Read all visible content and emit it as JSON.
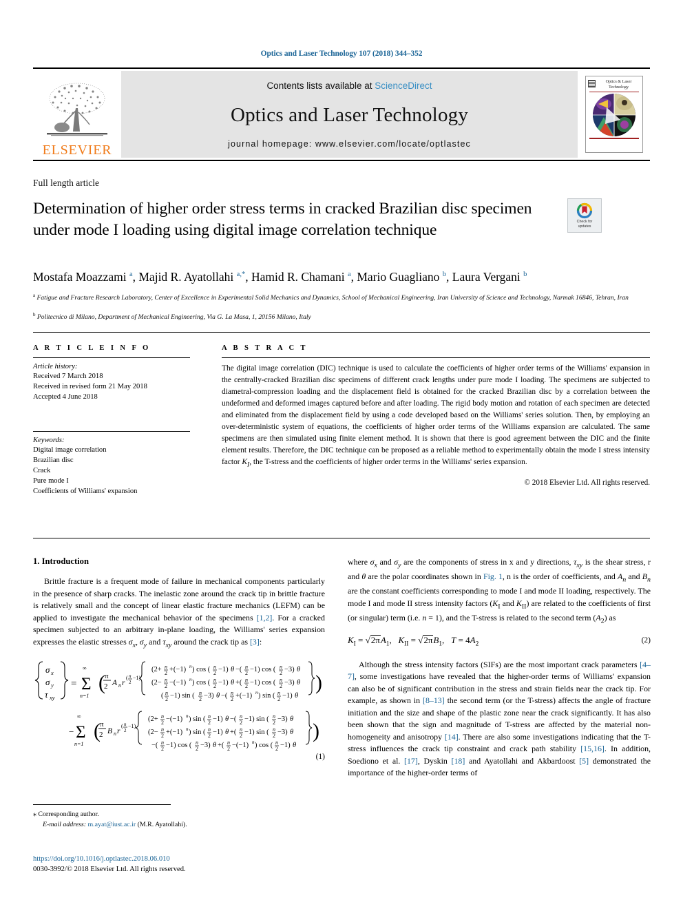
{
  "running_head": "Optics and Laser Technology 107 (2018) 344–352",
  "masthead": {
    "publisher": "ELSEVIER",
    "contents_prefix": "Contents lists available at ",
    "contents_link": "ScienceDirect",
    "journal_title": "Optics and Laser Technology",
    "homepage": "journal homepage: www.elsevier.com/locate/optlastec",
    "cover_title": "Optics & Laser Technology"
  },
  "article": {
    "type": "Full length article",
    "title": "Determination of higher order stress terms in cracked Brazilian disc specimen under mode I loading using digital image correlation technique",
    "crossmark_line1": "Check for",
    "crossmark_line2": "updates",
    "authors_html": "Mostafa Moazzami <sup>a</sup>, Majid R. Ayatollahi <sup>a,*</sup>, Hamid R. Chamani <sup>a</sup>, Mario Guagliano <sup>b</sup>, Laura Vergani <sup>b</sup>",
    "affiliation_a": "Fatigue and Fracture Research Laboratory, Center of Excellence in Experimental Solid Mechanics and Dynamics, School of Mechanical Engineering, Iran University of Science and Technology, Narmak 16846, Tehran, Iran",
    "affiliation_b": "Politecnico di Milano, Department of Mechanical Engineering, Via G. La Masa, 1, 20156 Milano, Italy"
  },
  "info": {
    "heading": "A R T I C L E   I N F O",
    "history_label": "Article history:",
    "history": [
      "Received 7 March 2018",
      "Received in revised form 21 May 2018",
      "Accepted 4 June 2018"
    ],
    "keywords_label": "Keywords:",
    "keywords": [
      "Digital image correlation",
      "Brazilian disc",
      "Crack",
      "Pure mode I",
      "Coefficients of Williams' expansion"
    ]
  },
  "abstract": {
    "heading": "A B S T R A C T",
    "text_html": "The digital image correlation (DIC) technique is used to calculate the coefficients of higher order terms of the Williams' expansion in the centrally-cracked Brazilian disc specimens of different crack lengths under pure mode I loading. The specimens are subjected to diametral-compression loading and the displacement field is obtained for the cracked Brazilian disc by a correlation between the undeformed and deformed images captured before and after loading. The rigid body motion and rotation of each specimen are detected and eliminated from the displacement field by using a code developed based on the Williams' series solution. Then, by employing an over-deterministic system of equations, the coefficients of higher order terms of the Williams expansion are calculated. The same specimens are then simulated using finite element method. It is shown that there is good agreement between the DIC and the finite element results. Therefore, the DIC technique can be proposed as a reliable method to experimentally obtain the mode I stress intensity factor <i>K<sub>I</sub></i>, the T-stress and the coefficients of higher order terms in the Williams' series expansion.",
    "copyright": "© 2018 Elsevier Ltd. All rights reserved."
  },
  "body": {
    "section_heading": "1. Introduction",
    "left_para1_html": "Brittle fracture is a frequent mode of failure in mechanical components particularly in the presence of sharp cracks. The inelastic zone around the crack tip in brittle fracture is relatively small and the concept of linear elastic fracture mechanics (LEFM) can be applied to investigate the mechanical behavior of the specimens <span class=\"ref\">[1,2]</span>. For a cracked specimen subjected to an arbitrary in-plane loading, the Williams' series expansion expresses the elastic stresses <i>σ<sub>x</sub></i>, <i>σ<sub>y</sub></i> and <i>τ<sub>xy</sub></i> around the crack tip as <span class=\"ref\">[3]</span>:",
    "equation1_number": "(1)",
    "right_para1_html": "where <i>σ<sub>x</sub></i> and <i>σ<sub>y</sub></i> are the components of stress in x and y directions, <i>τ<sub>xy</sub></i> is the shear stress, r and <i>θ</i> are the polar coordinates shown in <span class=\"ref\">Fig. 1</span>, n is the order of coefficients, and <i>A<sub>n</sub></i> and <i>B<sub>n</sub></i> are the constant coefficients corresponding to mode I and mode II loading, respectively. The mode I and mode II stress intensity factors (<i>K</i><sub>I</sub> and <i>K</i><sub>II</sub>) are related to the coefficients of first (or singular) term (i.e. <i>n</i> = 1), and the T-stress is related to the second term (<i>A</i><sub>2</sub>) as",
    "equation2_number": "(2)",
    "right_para2_html": "Although the stress intensity factors (SIFs) are the most important crack parameters <span class=\"ref\">[4–7]</span>, some investigations have revealed that the higher-order terms of Williams' expansion can also be of significant contribution in the stress and strain fields near the crack tip. For example, as shown in <span class=\"ref\">[8–13]</span> the second term (or the T-stress) affects the angle of fracture initiation and the size and shape of the plastic zone near the crack significantly. It has also been shown that the sign and magnitude of T-stress are affected by the material non-homogeneity and anisotropy <span class=\"ref\">[14]</span>. There are also some investigations indicating that the T-stress influences the crack tip constraint and crack path stability <span class=\"ref\">[15,16]</span>. In addition, Soediono et al. <span class=\"ref\">[17]</span>, Dyskin <span class=\"ref\">[18]</span> and Ayatollahi and Akbardoost <span class=\"ref\">[5]</span> demonstrated the importance of the higher-order terms of"
  },
  "footer": {
    "corresponding_marker": "⁎",
    "corresponding_text": "Corresponding author.",
    "email_label": "E-mail address:",
    "email": "m.ayat@iust.ac.ir",
    "email_owner": "(M.R. Ayatollahi).",
    "doi": "https://doi.org/10.1016/j.optlastec.2018.06.010",
    "issn_line": "0030-3992/© 2018 Elsevier Ltd. All rights reserved."
  },
  "colors": {
    "link": "#1a6496",
    "sciencedirect": "#3a8fc4",
    "elsevier_orange": "#f07c1c",
    "band_gray": "#e4e4e4"
  }
}
